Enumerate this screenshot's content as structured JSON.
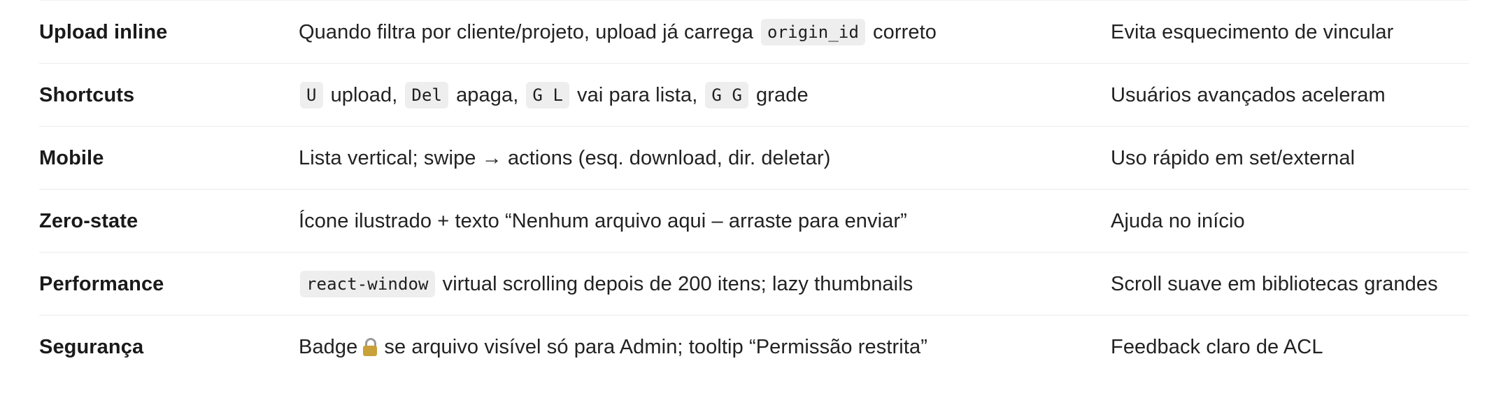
{
  "rows": [
    {
      "feature": "Upload inline",
      "desc": {
        "t1": "Quando filtra por cliente/projeto, upload já carrega",
        "code1": "origin_id",
        "t2": "correto"
      },
      "benefit": "Evita esquecimento de vincular"
    },
    {
      "feature": "Shortcuts",
      "desc": {
        "k1": "U",
        "t1": "upload,",
        "k2": "Del",
        "t2": "apaga,",
        "k3": "G L",
        "t3": "vai para lista,",
        "k4": "G G",
        "t4": "grade"
      },
      "benefit": "Usuários avançados aceleram"
    },
    {
      "feature": "Mobile",
      "desc": {
        "t1": "Lista vertical; swipe → actions (esq. download, dir. deletar)"
      },
      "benefit": "Uso rápido em set/external"
    },
    {
      "feature": "Zero-state",
      "desc": {
        "t1": "Ícone ilustrado + texto “Nenhum arquivo aqui – arraste para enviar”"
      },
      "benefit": "Ajuda no início"
    },
    {
      "feature": "Performance",
      "desc": {
        "code1": "react-window",
        "t1": "virtual scrolling depois de 200 itens; lazy thumbnails"
      },
      "benefit": "Scroll suave em bibliotecas grandes"
    },
    {
      "feature": "Segurança",
      "desc": {
        "t1": "Badge",
        "icon": "lock-icon",
        "t2": "se arquivo visível só para Admin; tooltip “Permissão restrita”"
      },
      "benefit": "Feedback claro de ACL"
    }
  ]
}
